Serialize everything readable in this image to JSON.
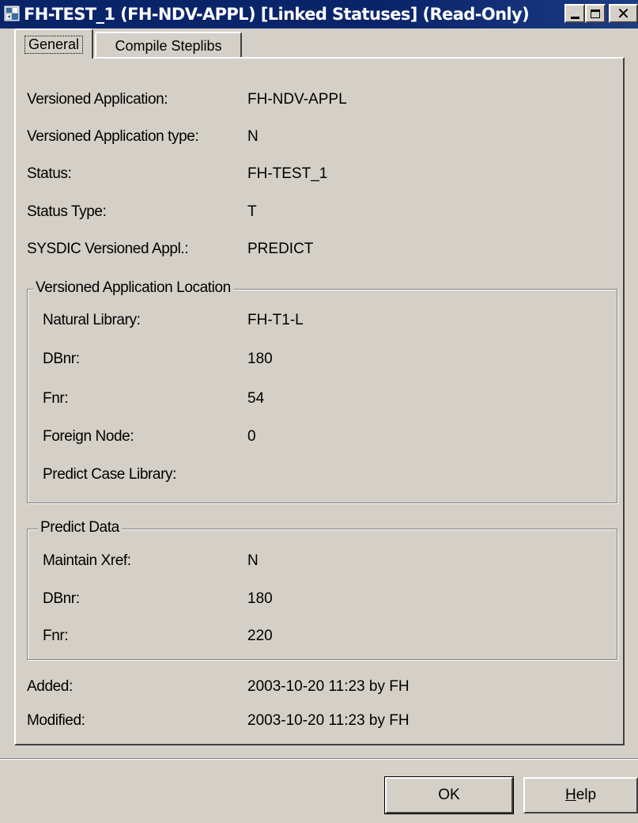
{
  "window": {
    "title": "FH-TEST_1 (FH-NDV-APPL) [Linked Statuses] (Read-Only)",
    "title_icon": "app-window-icon",
    "titlebar_color": "#0a246a",
    "controls": {
      "minimize": "minimize-icon",
      "maximize": "maximize-icon",
      "close": "✕"
    }
  },
  "tabs": [
    {
      "label": "General",
      "active": true
    },
    {
      "label": "Compile Steplibs",
      "active": false
    }
  ],
  "general": {
    "fields": [
      {
        "label": "Versioned Application:",
        "value": "FH-NDV-APPL"
      },
      {
        "label": "Versioned Application type:",
        "value": "N"
      },
      {
        "label": "Status:",
        "value": "FH-TEST_1"
      },
      {
        "label": "Status Type:",
        "value": "T"
      },
      {
        "label": "SYSDIC Versioned Appl.:",
        "value": "PREDICT"
      }
    ],
    "location_group": {
      "title": "Versioned Application Location",
      "fields": [
        {
          "label": "Natural Library:",
          "value": "FH-T1-L"
        },
        {
          "label": "DBnr:",
          "value": "180"
        },
        {
          "label": "Fnr:",
          "value": "54"
        },
        {
          "label": "Foreign Node:",
          "value": "0"
        },
        {
          "label": "Predict Case Library:",
          "value": ""
        }
      ]
    },
    "predict_group": {
      "title": "Predict Data",
      "fields": [
        {
          "label": "Maintain Xref:",
          "value": "N"
        },
        {
          "label": "DBnr:",
          "value": "180"
        },
        {
          "label": "Fnr:",
          "value": "220"
        }
      ]
    },
    "audit": [
      {
        "label": "Added:",
        "value": "2003-10-20 11:23 by FH"
      },
      {
        "label": "Modified:",
        "value": "2003-10-20 11:23 by FH"
      }
    ]
  },
  "buttons": {
    "ok": "OK",
    "help_mnemonic": "H",
    "help_rest": "elp"
  }
}
